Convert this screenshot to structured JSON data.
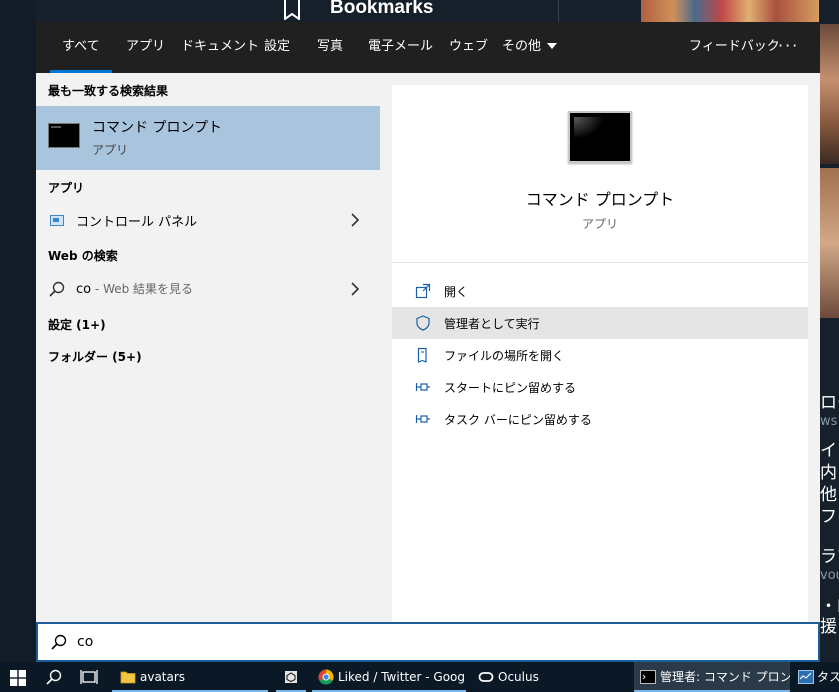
{
  "background_window": {
    "title": "Bookmarks",
    "right_texts": [
      "ロー",
      "ws",
      "イ",
      "内",
      "他",
      "フォ",
      "ラマ",
      "vou",
      "・N",
      "援"
    ]
  },
  "tabs": [
    {
      "label": "すべて",
      "active": true
    },
    {
      "label": "アプリ"
    },
    {
      "label": "ドキュメント"
    },
    {
      "label": "設定"
    },
    {
      "label": "写真"
    },
    {
      "label": "電子メール"
    },
    {
      "label": "ウェブ"
    },
    {
      "label": "その他"
    }
  ],
  "feedback_label": "フィードバック",
  "more_options_label": "···",
  "left": {
    "best_match_header": "最も一致する検索結果",
    "best_match": {
      "title": "コマンド プロンプト",
      "subtitle": "アプリ"
    },
    "apps_header": "アプリ",
    "apps": [
      {
        "label": "コントロール パネル"
      }
    ],
    "web_header": "Web の検索",
    "web_item": {
      "query": "co",
      "hint": " - Web 結果を見る"
    },
    "settings_header": "設定 (1+)",
    "folders_header": "フォルダー (5+)"
  },
  "right": {
    "title": "コマンド プロンプト",
    "subtitle": "アプリ",
    "actions": [
      {
        "label": "開く",
        "icon": "open-icon"
      },
      {
        "label": "管理者として実行",
        "icon": "shield-icon",
        "hover": true
      },
      {
        "label": "ファイルの場所を開く",
        "icon": "file-location-icon"
      },
      {
        "label": "スタートにピン留めする",
        "icon": "pin-icon"
      },
      {
        "label": "タスク バーにピン留めする",
        "icon": "pin-icon"
      }
    ]
  },
  "search": {
    "value": "co"
  },
  "taskbar": {
    "apps": [
      {
        "label": "avatars",
        "icon": "folder-icon"
      },
      {
        "label": "",
        "icon": "unity-icon"
      },
      {
        "label": "Liked / Twitter - Goog...",
        "icon": "chrome-icon"
      },
      {
        "label": "Oculus",
        "icon": "oculus-icon"
      },
      {
        "label": "管理者: コマンド プロンプト",
        "icon": "cmd-icon"
      },
      {
        "label": "タス",
        "icon": "task-icon"
      }
    ]
  },
  "colors": {
    "accent": "#0078d7",
    "selected_row": "#a9c5de",
    "tab_bar": "#202020",
    "action_icon": "#1a5fa8"
  }
}
